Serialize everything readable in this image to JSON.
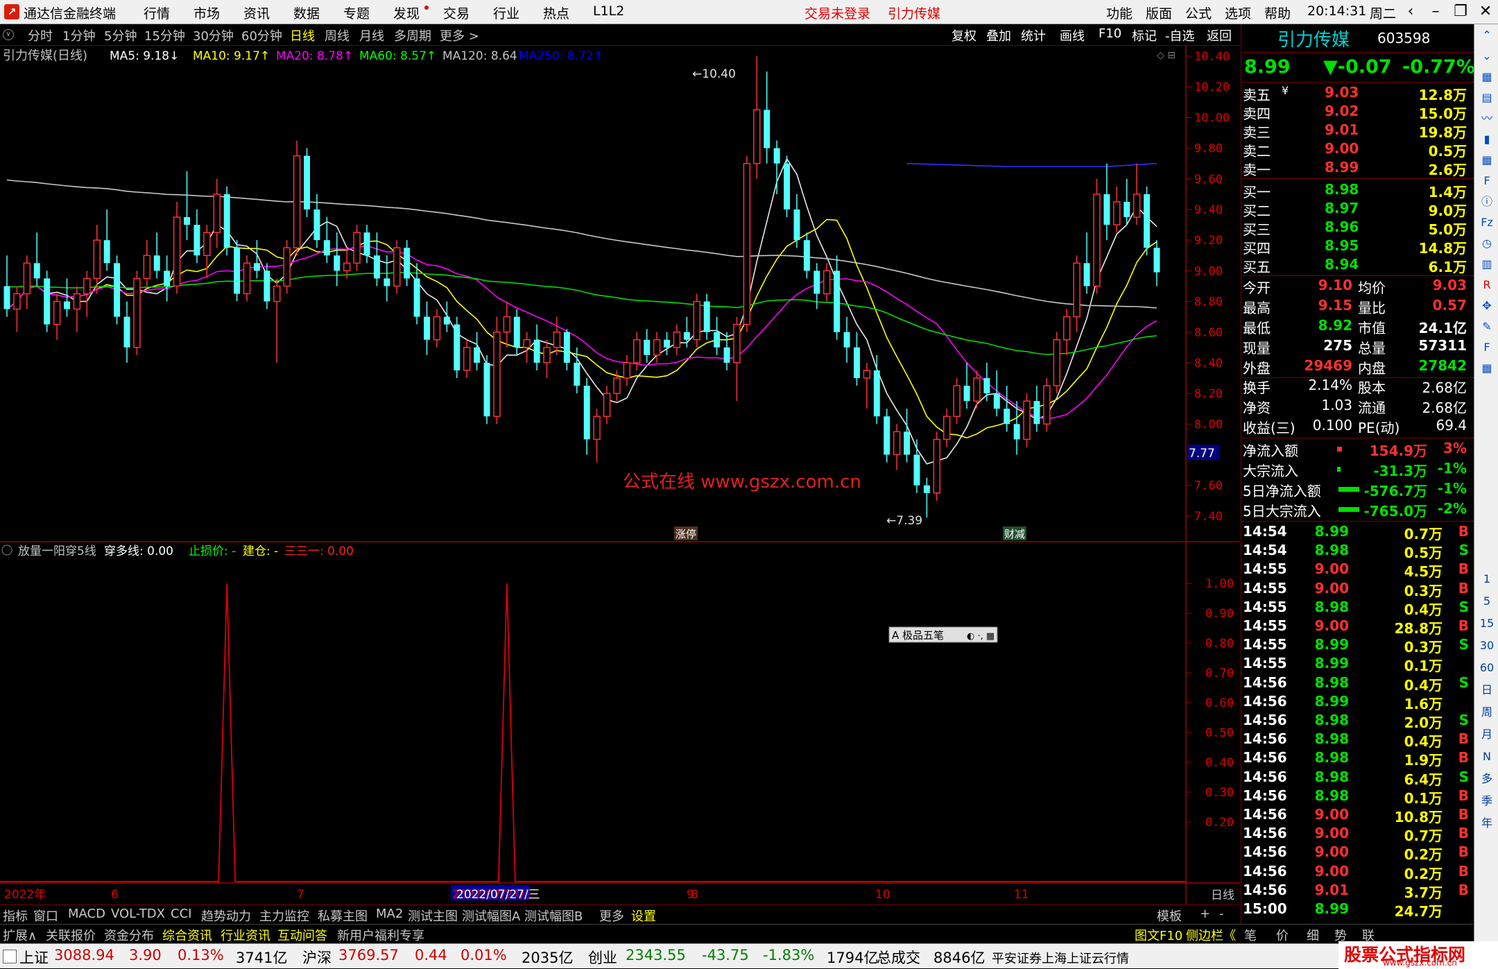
{
  "titlebar": {
    "app_name": "通达信金融终端",
    "menu": [
      "行情",
      "市场",
      "资讯",
      "数据",
      "专题",
      "发现",
      "交易",
      "行业",
      "热点",
      "L1L2"
    ],
    "trade_login": "交易未登录",
    "stock_name": "引力传媒",
    "right_menu": [
      "功能",
      "版面",
      "公式",
      "选项",
      "帮助"
    ],
    "clock": "20:14:31",
    "weekday": "周二"
  },
  "periodbar": {
    "periods": [
      "分时",
      "1分钟",
      "5分钟",
      "15分钟",
      "30分钟",
      "60分钟",
      "日线",
      "周线",
      "月线",
      "多周期",
      "更多 >"
    ],
    "active": "日线",
    "tools": [
      "复权",
      "叠加",
      "统计",
      "画线",
      "F10",
      "标记",
      "-自选",
      "返回"
    ]
  },
  "main_chart": {
    "title": "引力传媒(日线)",
    "ma": [
      {
        "label": "MA5: 9.18↓",
        "color": "#ffffff"
      },
      {
        "label": "MA10: 9.17↑",
        "color": "#ffff00"
      },
      {
        "label": "MA20: 8.78↑",
        "color": "#ff00ff"
      },
      {
        "label": "MA60: 8.57↑",
        "color": "#00ff00"
      },
      {
        "label": "MA120: 8.64",
        "color": "#c0c0c0"
      },
      {
        "label": "MA250: 8.72↑",
        "color": "#0000ff"
      }
    ],
    "high_marker": "10.40",
    "low_marker": "7.39",
    "price_box": "7.77",
    "watermark": "公式在线 www.gszx.com.cn",
    "event_tags": [
      "涨停",
      "财减"
    ]
  },
  "chart_data": {
    "type": "candlestick",
    "y_ticks": [
      "10.40",
      "10.20",
      "10.00",
      "9.80",
      "9.60",
      "9.40",
      "9.20",
      "9.00",
      "8.80",
      "8.60",
      "8.40",
      "8.20",
      "8.00",
      "7.60",
      "7.40"
    ],
    "x_labels": [
      "2022年",
      "6",
      "7",
      "2022/07/27/三",
      "8",
      "9",
      "10",
      "11"
    ],
    "ylim": [
      7.3,
      10.45
    ],
    "candles": [
      [
        8.9,
        9.1,
        8.7,
        8.75
      ],
      [
        8.75,
        8.9,
        8.6,
        8.85
      ],
      [
        8.85,
        9.1,
        8.75,
        9.05
      ],
      [
        9.05,
        9.25,
        8.9,
        8.95
      ],
      [
        8.95,
        9.0,
        8.6,
        8.65
      ],
      [
        8.65,
        8.85,
        8.55,
        8.8
      ],
      [
        8.8,
        8.95,
        8.7,
        8.75
      ],
      [
        8.75,
        8.9,
        8.6,
        8.85
      ],
      [
        8.85,
        9.0,
        8.7,
        8.95
      ],
      [
        8.95,
        9.3,
        8.85,
        9.2
      ],
      [
        9.2,
        9.4,
        9.0,
        9.05
      ],
      [
        9.05,
        9.1,
        8.65,
        8.7
      ],
      [
        8.7,
        8.8,
        8.4,
        8.5
      ],
      [
        8.5,
        9.0,
        8.45,
        8.95
      ],
      [
        8.95,
        9.2,
        8.9,
        9.1
      ],
      [
        9.1,
        9.25,
        8.95,
        9.0
      ],
      [
        9.0,
        9.1,
        8.8,
        8.9
      ],
      [
        8.9,
        9.45,
        8.85,
        9.35
      ],
      [
        9.35,
        9.65,
        9.2,
        9.3
      ],
      [
        9.3,
        9.4,
        9.05,
        9.1
      ],
      [
        9.1,
        9.3,
        8.95,
        9.25
      ],
      [
        9.25,
        9.6,
        9.15,
        9.5
      ],
      [
        9.5,
        9.55,
        9.1,
        9.15
      ],
      [
        9.15,
        9.2,
        8.8,
        8.85
      ],
      [
        8.85,
        9.1,
        8.8,
        9.05
      ],
      [
        9.05,
        9.2,
        8.95,
        9.0
      ],
      [
        9.0,
        9.05,
        8.75,
        8.8
      ],
      [
        8.8,
        8.95,
        8.4,
        8.9
      ],
      [
        8.9,
        9.2,
        8.85,
        9.15
      ],
      [
        9.15,
        9.85,
        9.1,
        9.75
      ],
      [
        9.75,
        9.8,
        9.35,
        9.4
      ],
      [
        9.4,
        9.5,
        9.15,
        9.2
      ],
      [
        9.2,
        9.35,
        9.05,
        9.1
      ],
      [
        9.1,
        9.25,
        8.9,
        9.0
      ],
      [
        9.0,
        9.15,
        8.95,
        9.05
      ],
      [
        9.05,
        9.3,
        9.0,
        9.25
      ],
      [
        9.25,
        9.3,
        9.05,
        9.1
      ],
      [
        9.1,
        9.25,
        8.9,
        8.95
      ],
      [
        8.95,
        9.1,
        8.8,
        8.9
      ],
      [
        8.9,
        9.2,
        8.85,
        9.15
      ],
      [
        9.15,
        9.2,
        8.9,
        8.95
      ],
      [
        8.95,
        9.05,
        8.65,
        8.7
      ],
      [
        8.7,
        8.8,
        8.45,
        8.55
      ],
      [
        8.55,
        8.75,
        8.5,
        8.7
      ],
      [
        8.7,
        8.8,
        8.6,
        8.65
      ],
      [
        8.65,
        8.7,
        8.3,
        8.35
      ],
      [
        8.35,
        8.55,
        8.3,
        8.5
      ],
      [
        8.5,
        8.6,
        8.35,
        8.4
      ],
      [
        8.4,
        8.45,
        8.0,
        8.05
      ],
      [
        8.05,
        8.7,
        8.0,
        8.6
      ],
      [
        8.6,
        8.8,
        8.5,
        8.7
      ],
      [
        8.7,
        8.75,
        8.45,
        8.5
      ],
      [
        8.5,
        8.6,
        8.4,
        8.55
      ],
      [
        8.55,
        8.65,
        8.35,
        8.4
      ],
      [
        8.4,
        8.55,
        8.3,
        8.5
      ],
      [
        8.5,
        8.7,
        8.45,
        8.6
      ],
      [
        8.6,
        8.62,
        8.35,
        8.4
      ],
      [
        8.4,
        8.5,
        8.2,
        8.25
      ],
      [
        8.25,
        8.3,
        7.8,
        7.9
      ],
      [
        7.9,
        8.1,
        7.75,
        8.05
      ],
      [
        8.05,
        8.25,
        8.0,
        8.2
      ],
      [
        8.2,
        8.35,
        8.15,
        8.3
      ],
      [
        8.3,
        8.45,
        8.25,
        8.4
      ],
      [
        8.4,
        8.6,
        8.35,
        8.55
      ],
      [
        8.55,
        8.62,
        8.4,
        8.45
      ],
      [
        8.45,
        8.6,
        8.4,
        8.55
      ],
      [
        8.55,
        8.6,
        8.45,
        8.5
      ],
      [
        8.5,
        8.65,
        8.45,
        8.6
      ],
      [
        8.6,
        8.7,
        8.5,
        8.55
      ],
      [
        8.55,
        8.85,
        8.5,
        8.8
      ],
      [
        8.8,
        8.85,
        8.55,
        8.6
      ],
      [
        8.6,
        8.7,
        8.45,
        8.5
      ],
      [
        8.5,
        8.6,
        8.35,
        8.4
      ],
      [
        8.4,
        8.7,
        8.15,
        8.65
      ],
      [
        8.65,
        9.75,
        8.6,
        9.7
      ],
      [
        9.7,
        10.4,
        9.6,
        10.05
      ],
      [
        10.05,
        10.3,
        9.7,
        9.8
      ],
      [
        9.8,
        9.85,
        9.5,
        9.7
      ],
      [
        9.7,
        9.75,
        9.35,
        9.4
      ],
      [
        9.4,
        9.5,
        9.15,
        9.2
      ],
      [
        9.2,
        9.25,
        8.95,
        9.0
      ],
      [
        9.0,
        9.05,
        8.75,
        8.85
      ],
      [
        8.85,
        9.05,
        8.8,
        9.0
      ],
      [
        9.0,
        9.1,
        8.55,
        8.6
      ],
      [
        8.6,
        8.7,
        8.4,
        8.5
      ],
      [
        8.5,
        8.6,
        8.25,
        8.3
      ],
      [
        8.3,
        8.4,
        8.1,
        8.35
      ],
      [
        8.35,
        8.45,
        8.0,
        8.05
      ],
      [
        8.05,
        8.1,
        7.75,
        7.8
      ],
      [
        7.8,
        8.0,
        7.7,
        7.95
      ],
      [
        7.95,
        8.1,
        7.75,
        7.8
      ],
      [
        7.8,
        7.9,
        7.55,
        7.6
      ],
      [
        7.6,
        7.65,
        7.39,
        7.55
      ],
      [
        7.55,
        7.95,
        7.5,
        7.9
      ],
      [
        7.9,
        8.1,
        7.85,
        8.05
      ],
      [
        8.05,
        8.3,
        8.0,
        8.25
      ],
      [
        8.25,
        8.4,
        8.1,
        8.15
      ],
      [
        8.15,
        8.35,
        8.1,
        8.3
      ],
      [
        8.3,
        8.4,
        8.15,
        8.2
      ],
      [
        8.2,
        8.35,
        8.05,
        8.1
      ],
      [
        8.1,
        8.25,
        7.95,
        8.0
      ],
      [
        8.0,
        8.15,
        7.8,
        7.9
      ],
      [
        7.9,
        8.2,
        7.85,
        8.15
      ],
      [
        8.15,
        8.25,
        7.95,
        8.0
      ],
      [
        8.0,
        8.3,
        7.95,
        8.25
      ],
      [
        8.25,
        8.6,
        8.2,
        8.55
      ],
      [
        8.55,
        8.75,
        8.45,
        8.7
      ],
      [
        8.7,
        9.1,
        8.6,
        9.05
      ],
      [
        9.05,
        9.25,
        8.85,
        8.9
      ],
      [
        8.9,
        9.6,
        8.85,
        9.5
      ],
      [
        9.5,
        9.7,
        9.2,
        9.3
      ],
      [
        9.3,
        9.55,
        9.25,
        9.45
      ],
      [
        9.45,
        9.6,
        9.3,
        9.35
      ],
      [
        9.35,
        9.7,
        9.3,
        9.5
      ],
      [
        9.5,
        9.55,
        9.1,
        9.15
      ],
      [
        9.15,
        9.2,
        8.9,
        8.99
      ]
    ],
    "ma_series": [
      {
        "name": "MA5",
        "color": "#e8e8e8"
      },
      {
        "name": "MA10",
        "color": "#ffff00"
      },
      {
        "name": "MA20",
        "color": "#ff00ff"
      },
      {
        "name": "MA60",
        "color": "#00dd00"
      },
      {
        "name": "MA120",
        "color": "#c8c8c8"
      },
      {
        "name": "MA250",
        "color": "#3030ff"
      }
    ]
  },
  "sub_chart": {
    "title": "放量一阳穿5线",
    "cross_label": "穿多线: 0.00",
    "stop_label": "止损价: -",
    "build_label": "建仓: -",
    "three_label": "三三一: 0.00",
    "y_ticks": [
      "1.00",
      "0.90",
      "0.80",
      "0.70",
      "0.60",
      "0.50",
      "0.40",
      "0.30",
      "0.20"
    ],
    "spike_candles": [
      22,
      50
    ],
    "ime_box": "A 极品五笔"
  },
  "quote": {
    "name": "引力传媒",
    "code": "603598",
    "price": "8.99",
    "change": "▼-0.07",
    "pct": "-0.77%",
    "asks": [
      {
        "l": "卖五",
        "p": "9.03",
        "v": "12.8万"
      },
      {
        "l": "卖四",
        "p": "9.02",
        "v": "15.0万"
      },
      {
        "l": "卖三",
        "p": "9.01",
        "v": "19.8万"
      },
      {
        "l": "卖二",
        "p": "9.00",
        "v": "0.5万"
      },
      {
        "l": "卖一",
        "p": "8.99",
        "v": "2.6万"
      }
    ],
    "bids": [
      {
        "l": "买一",
        "p": "8.98",
        "v": "1.4万"
      },
      {
        "l": "买二",
        "p": "8.97",
        "v": "9.0万"
      },
      {
        "l": "买三",
        "p": "8.96",
        "v": "5.0万"
      },
      {
        "l": "买四",
        "p": "8.95",
        "v": "14.8万"
      },
      {
        "l": "买五",
        "p": "8.94",
        "v": "6.1万"
      }
    ],
    "stats": [
      {
        "a": "今开",
        "av": "9.10",
        "ac": "red",
        "b": "均价",
        "bv": "9.03",
        "bc": "red"
      },
      {
        "a": "最高",
        "av": "9.15",
        "ac": "red",
        "b": "量比",
        "bv": "0.57",
        "bc": "red"
      },
      {
        "a": "最低",
        "av": "8.92",
        "ac": "grn",
        "b": "市值",
        "bv": "24.1亿",
        "bc": "wht"
      },
      {
        "a": "现量",
        "av": "275",
        "ac": "wht",
        "b": "总量",
        "bv": "57311",
        "bc": "wht"
      },
      {
        "a": "外盘",
        "av": "29469",
        "ac": "red",
        "b": "内盘",
        "bv": "27842",
        "bc": "grn"
      }
    ],
    "stats2": [
      {
        "a": "换手",
        "av": "2.14%",
        "b": "股本",
        "bv": "2.68亿"
      },
      {
        "a": "净资",
        "av": "1.03",
        "b": "流通",
        "bv": "2.68亿"
      },
      {
        "a": "收益(三)",
        "av": "0.100",
        "b": "PE(动)",
        "bv": "69.4"
      }
    ],
    "flows": [
      {
        "l": "净流入额",
        "v": "154.9万",
        "p": "3%",
        "c": "red"
      },
      {
        "l": "大宗流入",
        "v": "-31.3万",
        "p": "-1%",
        "c": "grn"
      },
      {
        "l": "5日净流入额",
        "v": "-576.7万",
        "p": "-1%",
        "c": "grn"
      },
      {
        "l": "5日大宗流入",
        "v": "-765.0万",
        "p": "-2%",
        "c": "grn"
      }
    ],
    "flow_bar_fraction": [
      0.1,
      0.05,
      1.0,
      1.0
    ],
    "ticks": [
      {
        "t": "14:54",
        "p": "8.99",
        "v": "0.7万",
        "d": "B"
      },
      {
        "t": "14:54",
        "p": "8.98",
        "v": "0.5万",
        "d": "S"
      },
      {
        "t": "14:55",
        "p": "9.00",
        "v": "4.5万",
        "d": "B"
      },
      {
        "t": "14:55",
        "p": "9.00",
        "v": "0.3万",
        "d": "B"
      },
      {
        "t": "14:55",
        "p": "8.98",
        "v": "0.4万",
        "d": "S"
      },
      {
        "t": "14:55",
        "p": "9.00",
        "v": "28.8万",
        "d": "B"
      },
      {
        "t": "14:55",
        "p": "8.99",
        "v": "0.3万",
        "d": "S"
      },
      {
        "t": "14:55",
        "p": "8.99",
        "v": "0.1万",
        "d": ""
      },
      {
        "t": "14:56",
        "p": "8.98",
        "v": "0.4万",
        "d": "S"
      },
      {
        "t": "14:56",
        "p": "8.99",
        "v": "1.6万",
        "d": ""
      },
      {
        "t": "14:56",
        "p": "8.98",
        "v": "2.0万",
        "d": "S"
      },
      {
        "t": "14:56",
        "p": "8.98",
        "v": "0.4万",
        "d": "B"
      },
      {
        "t": "14:56",
        "p": "8.98",
        "v": "1.9万",
        "d": "B"
      },
      {
        "t": "14:56",
        "p": "8.98",
        "v": "6.4万",
        "d": "S"
      },
      {
        "t": "14:56",
        "p": "8.98",
        "v": "0.1万",
        "d": "B"
      },
      {
        "t": "14:56",
        "p": "9.00",
        "v": "10.8万",
        "d": "B"
      },
      {
        "t": "14:56",
        "p": "9.00",
        "v": "0.7万",
        "d": "B"
      },
      {
        "t": "14:56",
        "p": "9.00",
        "v": "0.2万",
        "d": "B"
      },
      {
        "t": "14:56",
        "p": "9.00",
        "v": "0.2万",
        "d": "B"
      },
      {
        "t": "14:56",
        "p": "9.01",
        "v": "3.7万",
        "d": "B"
      },
      {
        "t": "15:00",
        "p": "8.99",
        "v": "24.7万",
        "d": ""
      }
    ]
  },
  "tabs1": [
    "指标",
    "窗口",
    "MACD",
    "VOL-TDX",
    "CCI",
    "趋势动力",
    "主力监控",
    "私募主图",
    "MA2",
    "测试主图",
    "测试幅图A",
    "测试幅图B",
    "更多",
    "设置",
    "模板",
    "+",
    "-"
  ],
  "tabs2": [
    "扩展∧",
    "关联报价",
    "资金分布",
    "综合资讯",
    "行业资讯",
    "互动问答",
    "新用户福利专享"
  ],
  "tabs2_right": [
    "图文F10",
    "侧边栏《",
    "笔",
    "价",
    "细",
    "势",
    "联"
  ],
  "x_right_label": "日线",
  "statusbar": {
    "sh_label": "上证",
    "sh_val": "3088.94",
    "sh_chg": "3.90",
    "sh_pct": "0.13%",
    "sh_amt": "3741亿",
    "hs_label": "沪深",
    "hs_val": "3769.57",
    "hs_chg": "0.44",
    "hs_pct": "0.01%",
    "hs_amt": "2035亿",
    "cy_label": "创业",
    "cy_val": "2343.55",
    "cy_chg": "-43.75",
    "cy_pct": "-1.83%",
    "cy_amt": "1794亿",
    "total_label": "总成交",
    "total_val": "8846亿",
    "broker": "平安证券上海上证云行情",
    "brand": "股票公式指标网",
    "brand_url": "www.gszx.com.cn"
  },
  "sidebar_icons": [
    "up-arrow-icon",
    "down-arrow-icon",
    "chart-icon",
    "table-icon",
    "line-icon",
    "candle-icon",
    "grid-icon",
    "f10-icon",
    "info-icon",
    "fz-icon",
    "clock-icon",
    "vol-icon",
    "rsi-icon",
    "move-icon",
    "pen-icon",
    "f-icon",
    "calc-icon"
  ],
  "sidebar_labels": [
    "1",
    "5",
    "15",
    "30",
    "60",
    "日",
    "周",
    "月",
    "N",
    "多",
    "季",
    "年"
  ]
}
